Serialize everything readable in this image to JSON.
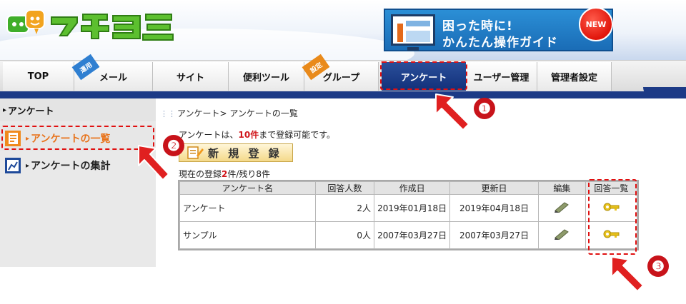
{
  "header": {
    "logo_text": "マチコミ",
    "banner": {
      "line1": "困った時に!",
      "line2": "かんたん操作ガイド",
      "badge": "NEW"
    }
  },
  "nav": {
    "tabs": [
      {
        "label": "TOP"
      },
      {
        "label": "メール",
        "tag": "運用"
      },
      {
        "label": "サイト"
      },
      {
        "label": "便利ツール"
      },
      {
        "label": "グループ",
        "tag": "設定"
      },
      {
        "label": "アンケート",
        "active": true
      },
      {
        "label": "ユーザー管理"
      },
      {
        "label": "管理者設定"
      }
    ]
  },
  "sidebar": {
    "heading": "アンケート",
    "items": [
      {
        "label": "アンケートの一覧",
        "active": true
      },
      {
        "label": "アンケートの集計"
      }
    ]
  },
  "main": {
    "breadcrumb": "アンケート> アンケートの一覧",
    "notice": {
      "prefix": "アンケートは、",
      "count": "10件",
      "suffix": "まで登録可能です。"
    },
    "new_button": "新 規 登 録",
    "registration": {
      "prefix": "現在の登録",
      "count": "2",
      "suffix": "件/残り8件"
    },
    "table": {
      "headers": [
        "アンケート名",
        "回答人数",
        "作成日",
        "更新日",
        "編集",
        "回答一覧"
      ],
      "rows": [
        {
          "name": "アンケート",
          "respondents": "2人",
          "created": "2019年01月18日",
          "updated": "2019年04月18日"
        },
        {
          "name": "サンプル",
          "respondents": "0人",
          "created": "2007年03月27日",
          "updated": "2007年03月27日"
        }
      ]
    }
  },
  "annotations": {
    "markers": [
      "❶",
      "❷",
      "❸"
    ]
  },
  "colors": {
    "nav_active": "#12307a",
    "sidebar_active_text": "#e8731b",
    "highlight_red": "#e01010",
    "count_red": "#d0161b"
  }
}
